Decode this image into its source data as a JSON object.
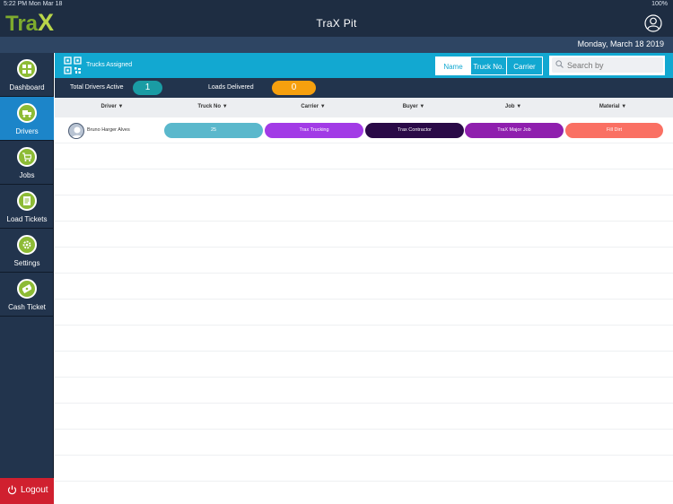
{
  "status_bar": {
    "left": "5:22 PM   Mon Mar 18",
    "right": "100%"
  },
  "header": {
    "logo_tra": "Tra",
    "logo_x": "X",
    "title": "TraX Pit",
    "profile_icon": "user-circle-icon"
  },
  "date": "Monday, March 18 2019",
  "sidebar": {
    "items": [
      {
        "label": "Dashboard",
        "icon": "dashboard-icon",
        "active": false
      },
      {
        "label": "Drivers",
        "icon": "truck-icon",
        "active": true
      },
      {
        "label": "Jobs",
        "icon": "cart-icon",
        "active": false
      },
      {
        "label": "Load Tickets",
        "icon": "ticket-icon",
        "active": false
      },
      {
        "label": "Settings",
        "icon": "gear-icon",
        "active": false
      },
      {
        "label": "Cash Ticket",
        "icon": "cash-icon",
        "active": false
      }
    ],
    "logout": "Logout"
  },
  "section": {
    "title": "Trucks Assigned",
    "filters": [
      "Name",
      "Truck No.",
      "Carrier"
    ],
    "selected_filter": "Name",
    "search_placeholder": "Search by"
  },
  "stats": {
    "active_label": "Total Drivers Active",
    "active_value": "1",
    "loads_label": "Loads Delivered",
    "loads_value": "0"
  },
  "table": {
    "columns": [
      "Driver ▼",
      "Truck No ▼",
      "Carrier ▼",
      "Buyer ▼",
      "Job ▼",
      "Material ▼"
    ],
    "rows": [
      {
        "driver": "Bruno Harger Alves",
        "truck": "25",
        "carrier": "Trax Trucking",
        "buyer": "Trax Contractor",
        "job": "TraX Major Job",
        "material": "Fill Dirt"
      }
    ]
  },
  "colors": {
    "header": "#1e2d42",
    "accent": "#12a8d1",
    "nav_active": "#1c85c9",
    "active_pill": "#1a9ca4",
    "loads_pill": "#f6a00e",
    "truck_pill": "#5ab8cc",
    "carrier_pill": "#a23be6",
    "buyer_pill": "#2a0a47",
    "job_pill": "#8f1fae",
    "material_pill": "#fa7063",
    "logout": "#d0202f"
  }
}
